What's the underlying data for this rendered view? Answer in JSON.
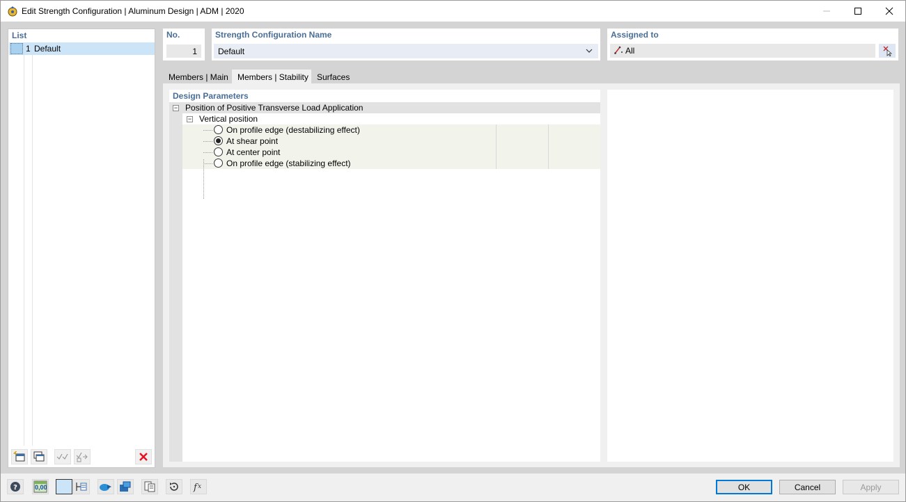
{
  "window": {
    "title": "Edit Strength Configuration | Aluminum Design | ADM | 2020"
  },
  "list": {
    "header": "List",
    "items": [
      {
        "number": "1",
        "name": "Default"
      }
    ]
  },
  "number": {
    "label": "No.",
    "value": "1"
  },
  "config_name": {
    "label": "Strength Configuration Name",
    "value": "Default"
  },
  "assigned": {
    "label": "Assigned to",
    "value": "All"
  },
  "tabs": [
    {
      "label": "Members | Main",
      "active": false
    },
    {
      "label": "Members | Stability",
      "active": true
    },
    {
      "label": "Surfaces",
      "active": false
    }
  ],
  "design": {
    "header": "Design Parameters",
    "group_label": "Position of Positive Transverse Load Application",
    "sub_label": "Vertical position",
    "options": [
      {
        "label": "On profile edge (destabilizing effect)",
        "checked": false
      },
      {
        "label": "At shear point",
        "checked": true
      },
      {
        "label": "At center point",
        "checked": false
      },
      {
        "label": "On profile edge (stabilizing effect)",
        "checked": false
      }
    ]
  },
  "bottom_tools": {
    "units_label": "0,00"
  },
  "buttons": {
    "ok": "OK",
    "cancel": "Cancel",
    "apply": "Apply"
  },
  "colors": {
    "accent": "#4a6e96",
    "selection": "#cce4f7",
    "delete": "#e81123"
  }
}
